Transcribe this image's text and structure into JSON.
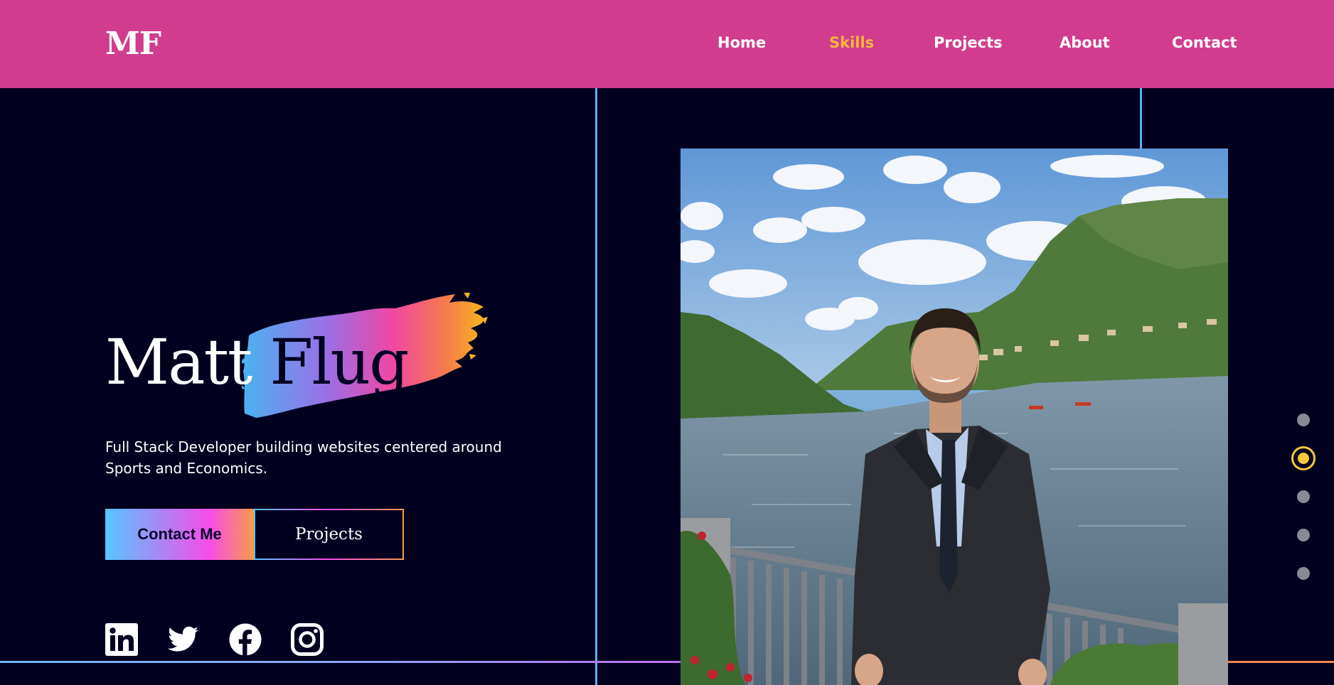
{
  "header": {
    "logo": "MF",
    "nav": [
      "Home",
      "Skills",
      "Projects",
      "About",
      "Contact"
    ],
    "active_nav": "Skills"
  },
  "hero": {
    "first_name": "Matt",
    "last_name": "Flug",
    "tagline": "Full Stack Developer building websites centered around Sports and Economics.",
    "contact_button": "Contact Me",
    "projects_button": "Projects"
  },
  "social": [
    "linkedin-icon",
    "twitter-icon",
    "facebook-icon",
    "instagram-icon"
  ],
  "pagination": {
    "count": 5,
    "active_index": 1
  },
  "colors": {
    "header_bg": "#d13c8f",
    "page_bg": "#02001f",
    "accent": "#f6b73c",
    "gradient": [
      "#55c6ff",
      "#f74de8",
      "#f99a4a"
    ]
  }
}
